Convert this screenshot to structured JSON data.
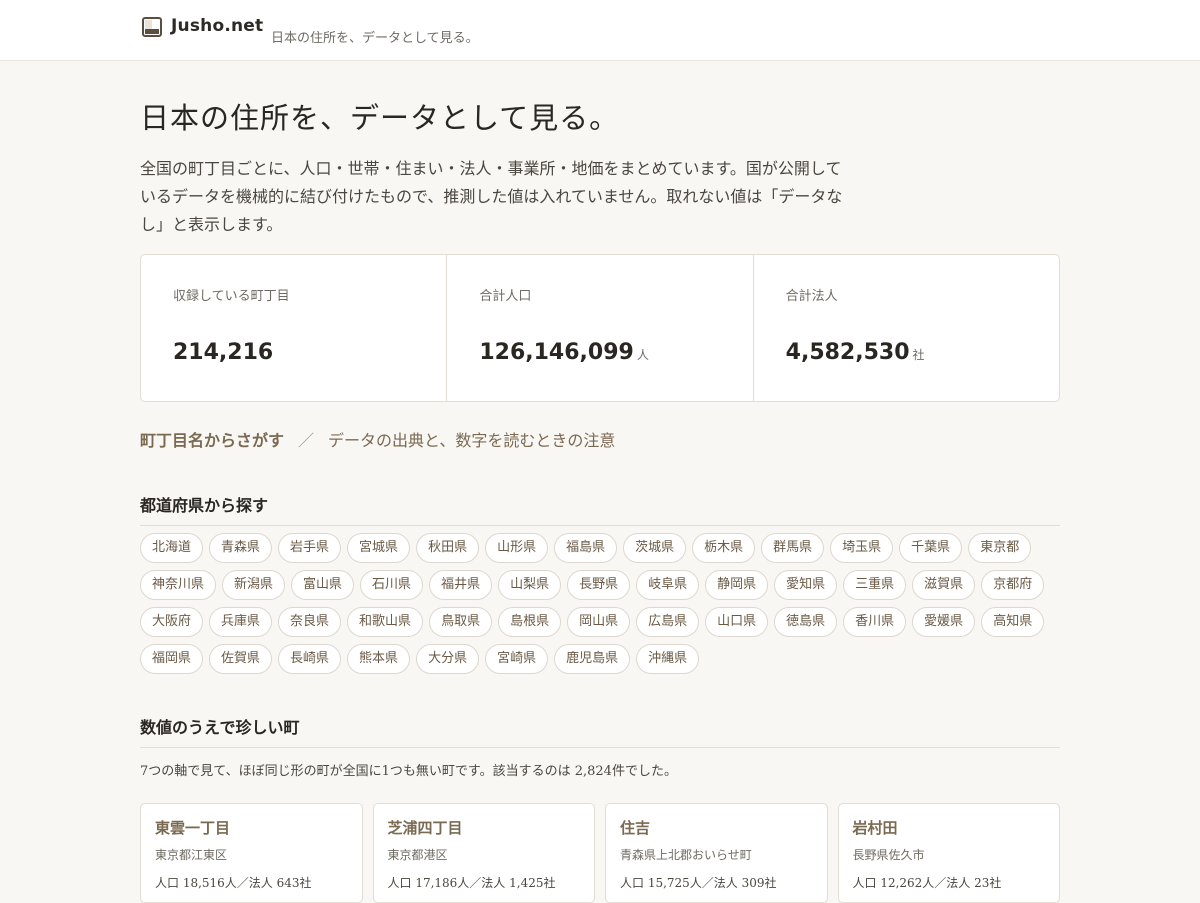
{
  "header": {
    "brand": "Jusho.net",
    "tagline": "日本の住所を、データとして見る。",
    "logo_icon": "map-block-icon"
  },
  "hero": {
    "title": "日本の住所を、データとして見る。",
    "intro": "全国の町丁目ごとに、人口・世帯・住まい・法人・事業所・地価をまとめています。国が公開しているデータを機械的に結び付けたもので、推測した値は入れていません。取れない値は「データなし」と表示します。"
  },
  "stats": [
    {
      "label": "収録している町丁目",
      "value": "214,216",
      "unit": ""
    },
    {
      "label": "合計人口",
      "value": "126,146,099",
      "unit": "人"
    },
    {
      "label": "合計法人",
      "value": "4,582,530",
      "unit": "社"
    }
  ],
  "nav": {
    "active": "町丁目名からさがす",
    "separator": "／",
    "link": "データの出典と、数字を読むときの注意"
  },
  "prefectures": {
    "title": "都道府県から探す",
    "items": [
      "北海道",
      "青森県",
      "岩手県",
      "宮城県",
      "秋田県",
      "山形県",
      "福島県",
      "茨城県",
      "栃木県",
      "群馬県",
      "埼玉県",
      "千葉県",
      "東京都",
      "神奈川県",
      "新潟県",
      "富山県",
      "石川県",
      "福井県",
      "山梨県",
      "長野県",
      "岐阜県",
      "静岡県",
      "愛知県",
      "三重県",
      "滋賀県",
      "京都府",
      "大阪府",
      "兵庫県",
      "奈良県",
      "和歌山県",
      "鳥取県",
      "島根県",
      "岡山県",
      "広島県",
      "山口県",
      "徳島県",
      "香川県",
      "愛媛県",
      "高知県",
      "福岡県",
      "佐賀県",
      "長崎県",
      "熊本県",
      "大分県",
      "宮崎県",
      "鹿児島県",
      "沖縄県"
    ]
  },
  "rare": {
    "title": "数値のうえで珍しい町",
    "description": "7つの軸で見て、ほぼ同じ形の町が全国に1つも無い町です。該当するのは 2,824件でした。",
    "cards": [
      {
        "name": "東雲一丁目",
        "address": "東京都江東区",
        "meta": "人口 18,516人／法人 643社"
      },
      {
        "name": "芝浦四丁目",
        "address": "東京都港区",
        "meta": "人口 17,186人／法人 1,425社"
      },
      {
        "name": "住吉",
        "address": "青森県上北郡おいらせ町",
        "meta": "人口 15,725人／法人 309社"
      },
      {
        "name": "岩村田",
        "address": "長野県佐久市",
        "meta": "人口 12,262人／法人 23社"
      }
    ]
  },
  "colors": {
    "background": "#f9f7f4",
    "accent": "#7a6a52",
    "border": "#e2ddd5"
  }
}
